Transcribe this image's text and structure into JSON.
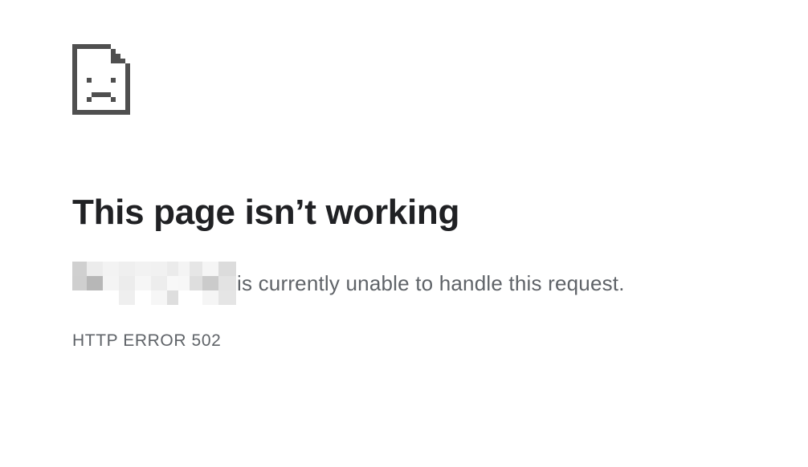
{
  "icon": {
    "name": "sad-page-icon",
    "color": "#4f4f4f"
  },
  "title": "This page isn’t working",
  "message": {
    "host_redacted": true,
    "text": "is currently unable to handle this request."
  },
  "error_code": "HTTP ERROR 502",
  "colors": {
    "title": "#202124",
    "secondary_text": "#5f6368",
    "background": "#ffffff"
  }
}
